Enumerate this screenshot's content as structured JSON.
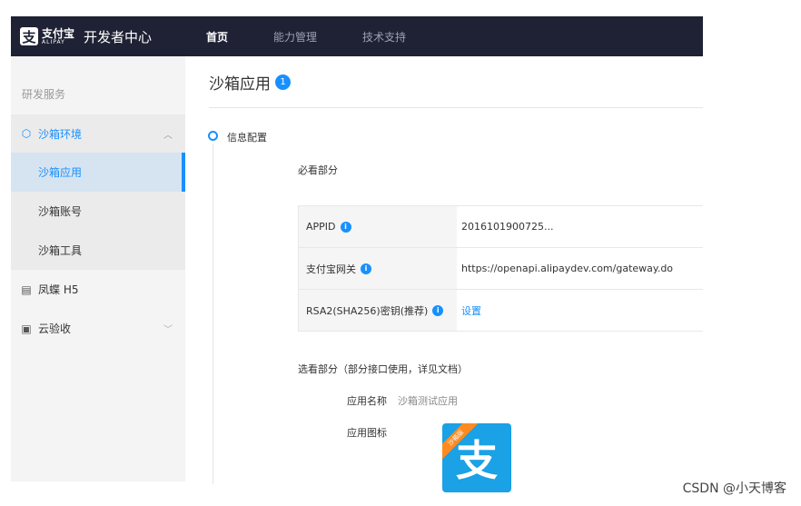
{
  "header": {
    "logo_glyph": "支",
    "logo_brand_cn": "支付宝",
    "logo_brand_en": "ALIPAY",
    "app_title": "开发者中心",
    "nav": [
      {
        "label": "首页",
        "active": true
      },
      {
        "label": "能力管理",
        "active": false
      },
      {
        "label": "技术支持",
        "active": false
      }
    ]
  },
  "sidebar": {
    "section_label": "研发服务",
    "group": {
      "label": "沙箱环境",
      "icon": "cube-icon",
      "expanded": true
    },
    "sub_items": [
      {
        "label": "沙箱应用",
        "active": true
      },
      {
        "label": "沙箱账号",
        "active": false
      },
      {
        "label": "沙箱工具",
        "active": false
      }
    ],
    "items": [
      {
        "label": "凤蝶 H5",
        "icon": "layout-icon"
      },
      {
        "label": "云验收",
        "icon": "document-check-icon"
      }
    ]
  },
  "main": {
    "page_title": "沙箱应用",
    "page_badge": "1",
    "step_label": "信息配置",
    "required_title": "必看部分",
    "info_rows": [
      {
        "key": "APPID",
        "value": "2016101900725..."
      },
      {
        "key": "支付宝网关",
        "value": "https://openapi.alipaydev.com/gateway.do"
      },
      {
        "key": "RSA2(SHA256)密钥(推荐)",
        "value": "设置"
      }
    ],
    "optional_title": "选看部分（部分接口使用，详见文档）",
    "app_name_label": "应用名称",
    "app_name_value": "沙箱测试应用",
    "app_icon_label": "应用图标",
    "app_icon_ribbon": "沙箱版",
    "app_icon_glyph": "支"
  },
  "watermark": "CSDN @小天博客",
  "colors": {
    "accent": "#1890ff",
    "topbar": "#1f2234",
    "icon_bg": "#1aa1e6",
    "ribbon": "#ff8a1f"
  }
}
